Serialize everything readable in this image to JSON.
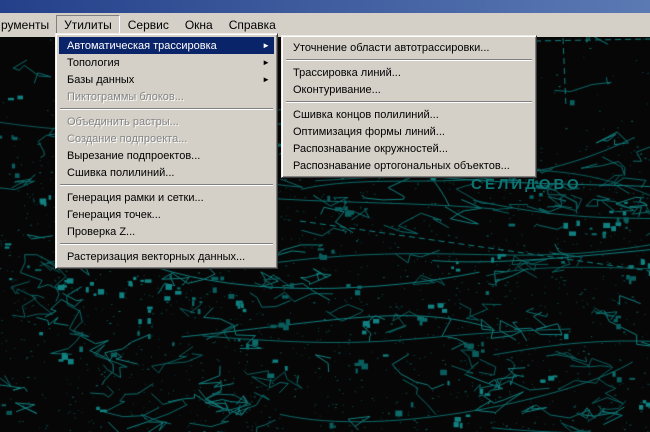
{
  "menubar": {
    "items": [
      {
        "label": "рументы"
      },
      {
        "label": "Утилиты",
        "active": true
      },
      {
        "label": "Сервис"
      },
      {
        "label": "Окна"
      },
      {
        "label": "Справка"
      }
    ]
  },
  "utilities_menu": {
    "items": [
      {
        "type": "item",
        "label": "Автоматическая трассировка",
        "has_submenu": true,
        "highlighted": true
      },
      {
        "type": "item",
        "label": "Топология",
        "has_submenu": true
      },
      {
        "type": "item",
        "label": "Базы данных",
        "has_submenu": true
      },
      {
        "type": "item",
        "label": "Пиктограммы блоков...",
        "disabled": true
      },
      {
        "type": "separator"
      },
      {
        "type": "item",
        "label": "Объединить растры...",
        "disabled": true
      },
      {
        "type": "item",
        "label": "Создание подпроекта...",
        "disabled": true
      },
      {
        "type": "item",
        "label": "Вырезание подпроектов..."
      },
      {
        "type": "item",
        "label": "Сшивка полилиний..."
      },
      {
        "type": "separator"
      },
      {
        "type": "item",
        "label": "Генерация рамки и сетки..."
      },
      {
        "type": "item",
        "label": "Генерация точек..."
      },
      {
        "type": "item",
        "label": "Проверка Z..."
      },
      {
        "type": "separator"
      },
      {
        "type": "item",
        "label": "Растеризация векторных данных..."
      }
    ]
  },
  "autotrace_submenu": {
    "items": [
      {
        "type": "item",
        "label": "Уточнение области автотрассировки..."
      },
      {
        "type": "separator"
      },
      {
        "type": "item",
        "label": "Трассировка линий..."
      },
      {
        "type": "item",
        "label": "Оконтуривание..."
      },
      {
        "type": "separator"
      },
      {
        "type": "item",
        "label": "Сшивка концов полилиний..."
      },
      {
        "type": "item",
        "label": "Оптимизация формы линий..."
      },
      {
        "type": "item",
        "label": "Распознавание окружностей..."
      },
      {
        "type": "item",
        "label": "Распознавание ортогональных объектов..."
      }
    ]
  },
  "map": {
    "label": "СЕЛИДОВО",
    "background": "#060606",
    "ink": "#0c6b6b",
    "ink_bright": "#118080",
    "ink_dark": "#0a5d5d"
  },
  "icons": {
    "submenu_arrow": "►"
  },
  "colors": {
    "menu_bg": "#d4d0c8",
    "highlight": "#0a246a",
    "highlight_text": "#ffffff",
    "disabled_text": "#848484",
    "titlebar_left": "#24408a",
    "titlebar_right": "#5b7ab4"
  }
}
